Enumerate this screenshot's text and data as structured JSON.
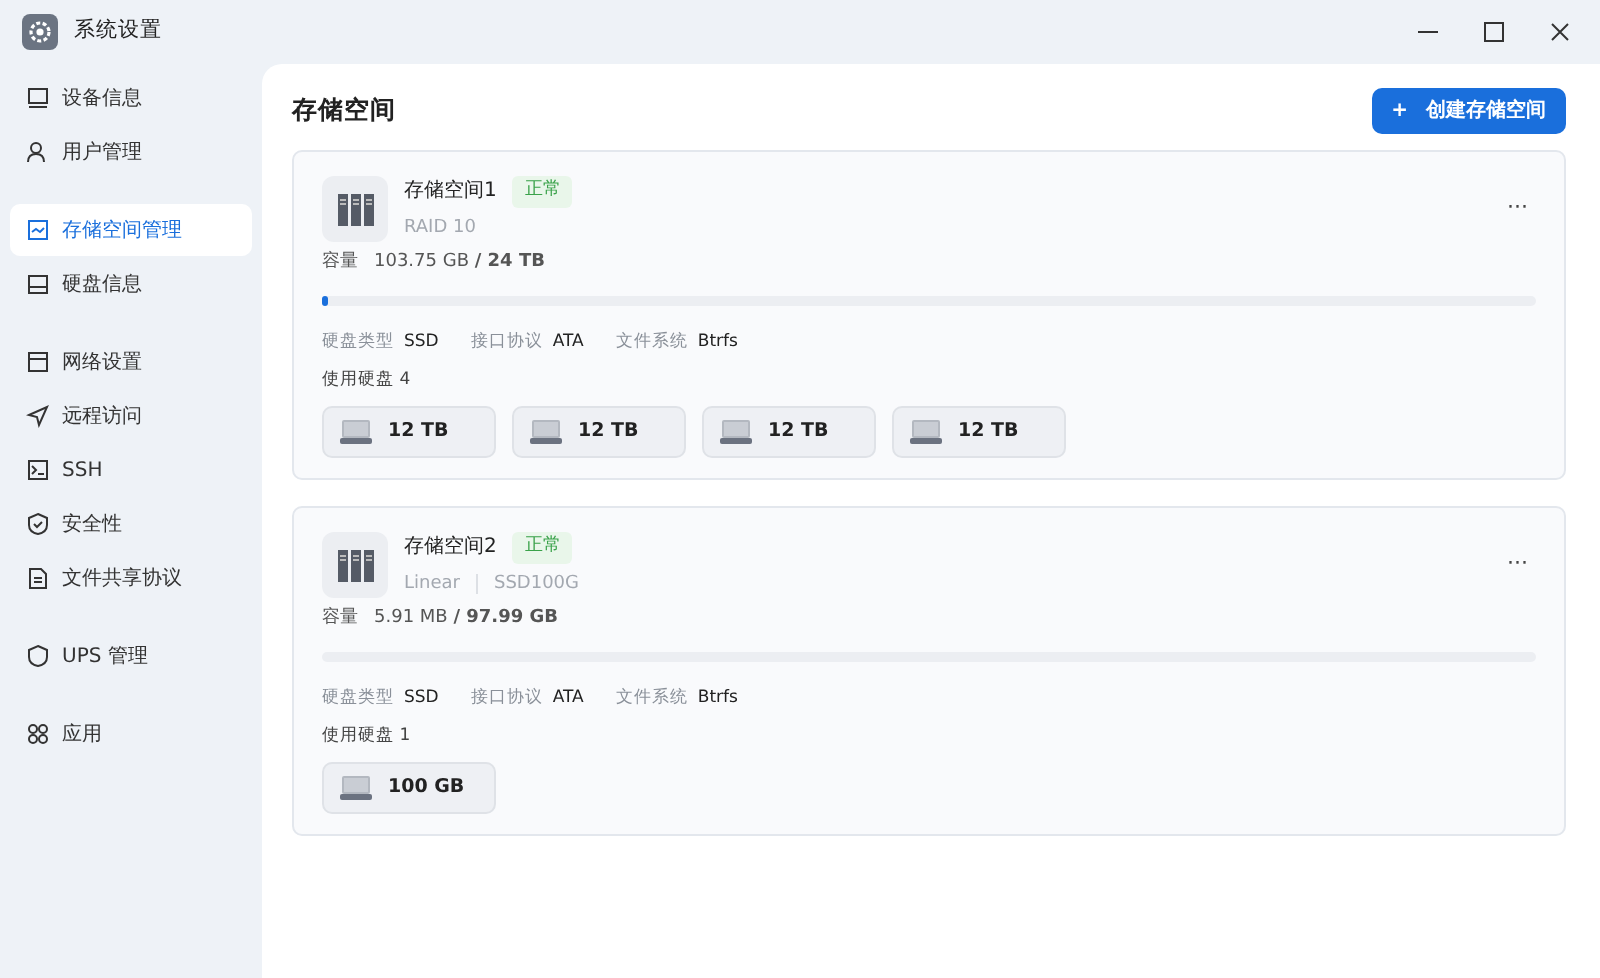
{
  "window": {
    "title": "系统设置"
  },
  "sidebar": {
    "groups": [
      {
        "items": [
          {
            "label": "设备信息",
            "selected": false
          },
          {
            "label": "用户管理",
            "selected": false
          }
        ]
      },
      {
        "items": [
          {
            "label": "存储空间管理",
            "selected": true
          },
          {
            "label": "硬盘信息",
            "selected": false
          }
        ]
      },
      {
        "items": [
          {
            "label": "网络设置",
            "selected": false
          },
          {
            "label": "远程访问",
            "selected": false
          },
          {
            "label": "SSH",
            "selected": false
          },
          {
            "label": "安全性",
            "selected": false
          },
          {
            "label": "文件共享协议",
            "selected": false
          }
        ]
      },
      {
        "items": [
          {
            "label": "UPS 管理",
            "selected": false
          }
        ]
      },
      {
        "items": [
          {
            "label": "应用",
            "selected": false
          }
        ]
      }
    ]
  },
  "page": {
    "title": "存储空间",
    "create_button": {
      "icon": "+",
      "label": "创建存储空间"
    }
  },
  "pools": [
    {
      "name": "存储空间1",
      "status": "正常",
      "subtitle": [
        "RAID 10"
      ],
      "capacity_label": "容量",
      "capacity": "103.75 GB **/ 24 TB**",
      "level": 0.004,
      "more": "···",
      "specs": [
        {
          "label": "硬盘类型",
          "value": "SSD"
        },
        {
          "label": "接口协议",
          "value": "ATA"
        },
        {
          "label": "文件系统",
          "value": "Btrfs"
        }
      ],
      "disks_label": "使用硬盘 4",
      "disks": [
        {
          "size": "12 TB"
        },
        {
          "size": "12 TB"
        },
        {
          "size": "12 TB"
        },
        {
          "size": "12 TB"
        }
      ]
    },
    {
      "name": "存储空间2",
      "status": "正常",
      "subtitle": [
        "Linear",
        "SSD100G"
      ],
      "capacity_label": "容量",
      "capacity": "5.91 MB **/ 97.99 GB**",
      "level": 0,
      "more": "···",
      "specs": [
        {
          "label": "硬盘类型",
          "value": "SSD"
        },
        {
          "label": "接口协议",
          "value": "ATA"
        },
        {
          "label": "文件系统",
          "value": "Btrfs"
        }
      ],
      "disks_label": "使用硬盘 1",
      "disks": [
        {
          "size": "100 GB"
        }
      ]
    }
  ]
}
